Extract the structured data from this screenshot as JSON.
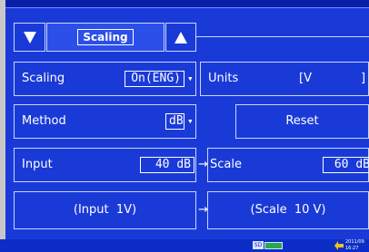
{
  "header": {
    "title": "Scaling"
  },
  "rows": {
    "scaling": {
      "label": "Scaling",
      "value": "On(ENG)"
    },
    "units": {
      "label": "Units",
      "value": "[V",
      "suffix": "]"
    },
    "method": {
      "label": "Method",
      "value": "dB"
    },
    "reset": {
      "label": "Reset"
    },
    "input": {
      "label": "Input",
      "value": "40",
      "unit": "dB"
    },
    "scale": {
      "label": "Scale",
      "value": "60",
      "unit": "dB"
    },
    "input_ref": {
      "text": "(Input  1V)"
    },
    "scale_ref": {
      "text": "(Scale  10 V)"
    }
  },
  "arrows": {
    "right": "→",
    "dropdown": "▾"
  },
  "status": {
    "sd_label": "SD",
    "date": "2011/09",
    "time": "16:27"
  },
  "colors": {
    "background": "#0a1fa8",
    "panel": "#1a3ad8",
    "border": "#c9d6ff"
  }
}
